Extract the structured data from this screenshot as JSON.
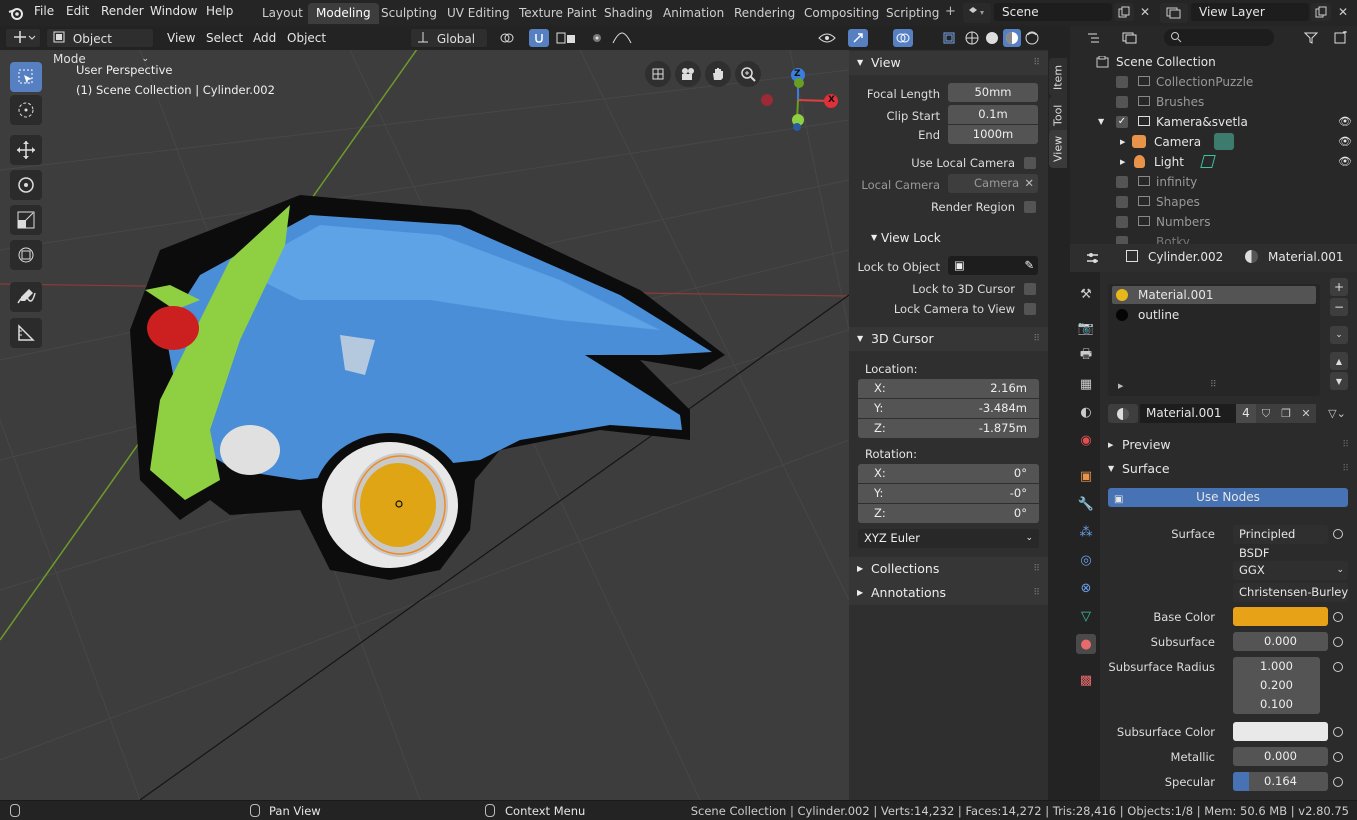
{
  "topbar": {
    "menus": [
      "File",
      "Edit",
      "Render",
      "Window",
      "Help"
    ],
    "workspaces": [
      "Layout",
      "Modeling",
      "Sculpting",
      "UV Editing",
      "Texture Paint",
      "Shading",
      "Animation",
      "Rendering",
      "Compositing",
      "Scripting"
    ],
    "active_workspace": "Modeling",
    "scene": "Scene",
    "view_layer": "View Layer"
  },
  "viewport_header": {
    "mode": "Object Mode",
    "menus": [
      "View",
      "Select",
      "Add",
      "Object"
    ],
    "orientation": "Global"
  },
  "viewport": {
    "perspective": "User Perspective",
    "collection_info": "(1) Scene Collection | Cylinder.002",
    "gizmo": {
      "z": "Z",
      "x": "X"
    }
  },
  "npanel": {
    "tabs": [
      "Item",
      "Tool",
      "View"
    ],
    "view": {
      "title": "View",
      "focal_length_label": "Focal Length",
      "focal_length": "50mm",
      "clip_start_label": "Clip Start",
      "clip_start": "0.1m",
      "end_label": "End",
      "end": "1000m",
      "use_local_camera": "Use Local Camera",
      "local_camera_label": "Local Camera",
      "local_camera": "Camera",
      "render_region": "Render Region"
    },
    "view_lock": {
      "title": "View Lock",
      "lock_to_object": "Lock to Object",
      "lock_to_3d_cursor": "Lock to 3D Cursor",
      "lock_camera_to_view": "Lock Camera to View"
    },
    "cursor": {
      "title": "3D Cursor",
      "location_label": "Location:",
      "loc": [
        {
          "k": "X:",
          "v": "2.16m"
        },
        {
          "k": "Y:",
          "v": "-3.484m"
        },
        {
          "k": "Z:",
          "v": "-1.875m"
        }
      ],
      "rotation_label": "Rotation:",
      "rot": [
        {
          "k": "X:",
          "v": "0°"
        },
        {
          "k": "Y:",
          "v": "-0°"
        },
        {
          "k": "Z:",
          "v": "0°"
        }
      ],
      "rotation_mode": "XYZ Euler"
    },
    "collections": "Collections",
    "annotations": "Annotations"
  },
  "outliner": {
    "root": "Scene Collection",
    "items": [
      "CollectionPuzzle",
      "Brushes",
      "Kamera&svetla",
      "Camera",
      "Light",
      "infinity",
      "Shapes",
      "Numbers",
      "Botky"
    ]
  },
  "properties": {
    "object": "Cylinder.002",
    "material": "Material.001",
    "slots": [
      "Material.001",
      "outline"
    ],
    "material_field": "Material.001",
    "users": "4",
    "preview": "Preview",
    "surface_section": "Surface",
    "use_nodes": "Use Nodes",
    "surface_label": "Surface",
    "surface_value": "Principled BSDF",
    "distribution": "GGX",
    "subsurface_method": "Christensen-Burley",
    "base_color_label": "Base Color",
    "base_color": "#e8a218",
    "subsurface_label": "Subsurface",
    "subsurface": "0.000",
    "subsurface_radius_label": "Subsurface Radius",
    "subsurface_radius": [
      "1.000",
      "0.200",
      "0.100"
    ],
    "subsurface_color_label": "Subsurface Color",
    "subsurface_color": "#e9e9e9",
    "metallic_label": "Metallic",
    "metallic": "0.000",
    "specular_label": "Specular",
    "specular": "0.164",
    "specular_fill": 0.164
  },
  "statusbar": {
    "pan": "Pan View",
    "context": "Context Menu",
    "stats": "Scene Collection | Cylinder.002 | Verts:14,232 | Faces:14,272 | Tris:28,416 | Objects:1/8 | Mem: 50.6 MB | v2.80.75"
  }
}
